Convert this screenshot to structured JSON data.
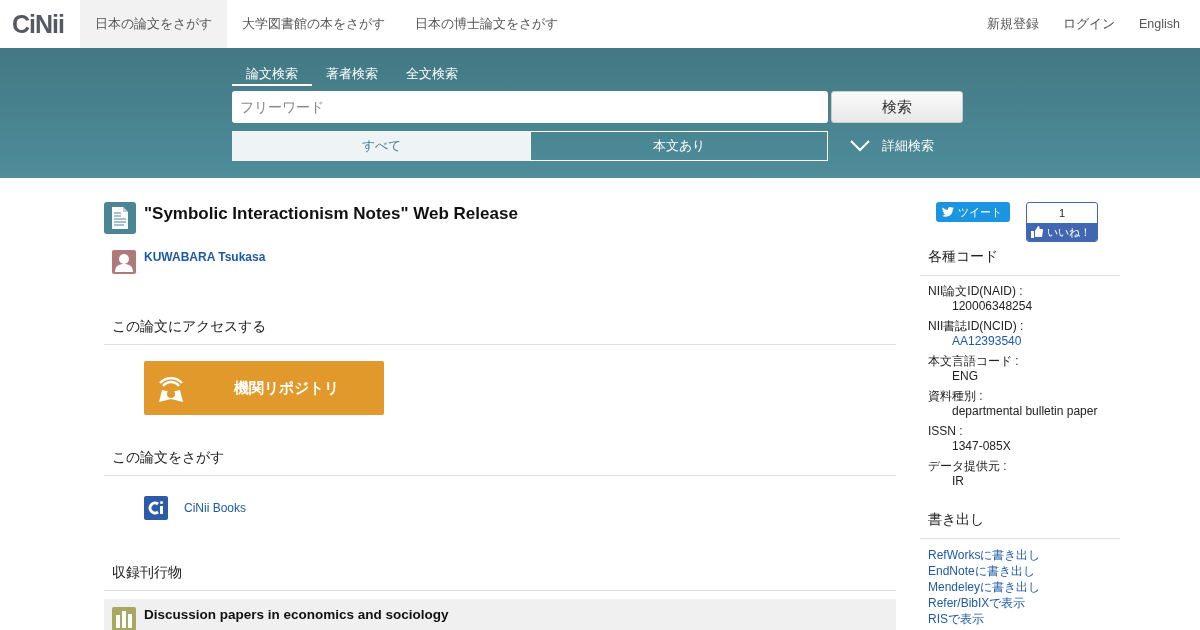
{
  "header": {
    "logo": "CiNii",
    "nav": [
      {
        "label": "日本の論文をさがす",
        "selected": true
      },
      {
        "label": "大学図書館の本をさがす",
        "selected": false
      },
      {
        "label": "日本の博士論文をさがす",
        "selected": false
      }
    ],
    "links": [
      "新規登録",
      "ログイン",
      "English"
    ]
  },
  "search": {
    "tabs": [
      {
        "label": "論文検索",
        "selected": true
      },
      {
        "label": "著者検索",
        "selected": false
      },
      {
        "label": "全文検索",
        "selected": false
      }
    ],
    "placeholder": "フリーワード",
    "button": "検索",
    "filters": [
      {
        "label": "すべて",
        "selected": true
      },
      {
        "label": "本文あり",
        "selected": false
      }
    ],
    "advanced": "詳細検索"
  },
  "article": {
    "title": "\"Symbolic Interactionism Notes\" Web Release",
    "authors": [
      {
        "name": "KUWABARA Tsukasa"
      }
    ]
  },
  "access": {
    "heading": "この論文にアクセスする",
    "button": "機関リポジトリ"
  },
  "find": {
    "heading": "この論文をさがす",
    "links": [
      "CiNii Books"
    ]
  },
  "publication": {
    "heading": "収録刊行物",
    "title": "Discussion papers in economics and sociology"
  },
  "sidebar": {
    "share": {
      "tweet": "ツイート",
      "like_count": "1",
      "like": "いいね！"
    },
    "codes_heading": "各種コード",
    "codes": [
      {
        "label": "NII論文ID(NAID) :",
        "value": "120006348254",
        "kind": "text"
      },
      {
        "label": "NII書誌ID(NCID) :",
        "value": "AA12393540",
        "kind": "link"
      },
      {
        "label": "本文言語コード :",
        "value": "ENG",
        "kind": "text"
      },
      {
        "label": "資料種別 :",
        "value": "departmental bulletin paper",
        "kind": "text"
      },
      {
        "label": "ISSN :",
        "value": "1347-085X",
        "kind": "text"
      },
      {
        "label": "データ提供元 :",
        "value": "IR",
        "kind": "text"
      }
    ],
    "export_heading": "書き出し",
    "export_links": [
      "RefWorksに書き出し",
      "EndNoteに書き出し",
      "Mendeleyに書き出し",
      "Refer/BibIXで表示",
      "RISで表示"
    ]
  }
}
